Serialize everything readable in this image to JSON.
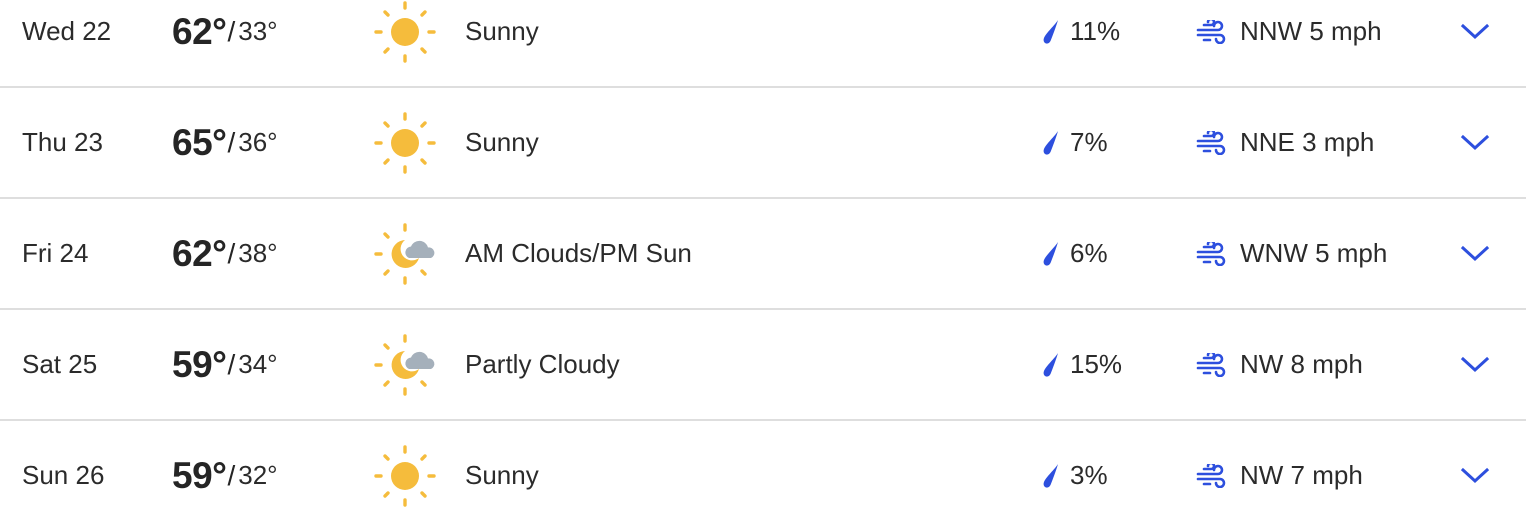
{
  "colors": {
    "accent": "#2d4fde",
    "sun": "#f5bc3c",
    "cloud": "#a5b0bb",
    "divider": "#dedede",
    "text": "#252525"
  },
  "forecast": [
    {
      "day": "Wed 22",
      "high": "62°",
      "low": "33°",
      "icon": "sunny-icon",
      "condition": "Sunny",
      "precip": "11%",
      "wind": "NNW 5 mph"
    },
    {
      "day": "Thu 23",
      "high": "65°",
      "low": "36°",
      "icon": "sunny-icon",
      "condition": "Sunny",
      "precip": "7%",
      "wind": "NNE 3 mph"
    },
    {
      "day": "Fri 24",
      "high": "62°",
      "low": "38°",
      "icon": "partly-cloudy-icon",
      "condition": "AM Clouds/PM Sun",
      "precip": "6%",
      "wind": "WNW 5 mph"
    },
    {
      "day": "Sat 25",
      "high": "59°",
      "low": "34°",
      "icon": "partly-cloudy-icon",
      "condition": "Partly Cloudy",
      "precip": "15%",
      "wind": "NW 8 mph"
    },
    {
      "day": "Sun 26",
      "high": "59°",
      "low": "32°",
      "icon": "sunny-icon",
      "condition": "Sunny",
      "precip": "3%",
      "wind": "NW 7 mph"
    }
  ],
  "separator": "/"
}
